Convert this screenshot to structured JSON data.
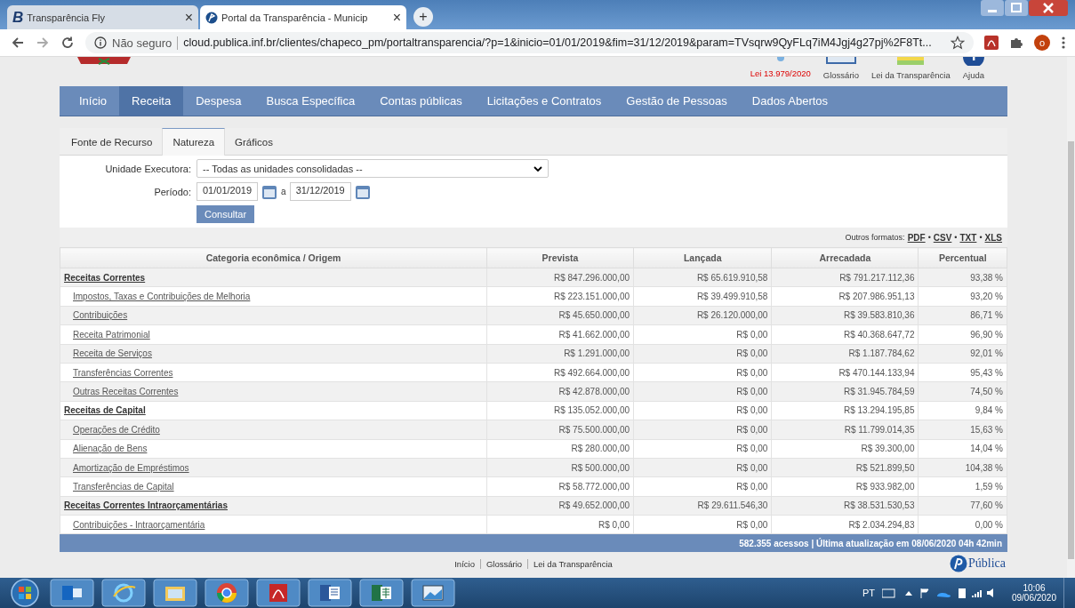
{
  "browser": {
    "tabs": [
      {
        "logo": "B",
        "title": "Transparência Fly",
        "close": "×",
        "selected": false
      },
      {
        "title": "Portal da Transparência - Municip",
        "close": "×",
        "selected": true
      }
    ],
    "new_tab": "+",
    "address": {
      "security": "Não seguro",
      "url": "cloud.publica.inf.br/clientes/chapeco_pm/portaltransparencia/?p=1&inicio=01/01/2019&fim=31/12/2019&param=TVsqrw9QyFLq7iM4Jgj4g27pj%2F8Tt..."
    },
    "profile": "o"
  },
  "header_links": [
    {
      "label": "Lei 13.979/2020",
      "highlight": true
    },
    {
      "label": "Glossário",
      "highlight": false
    },
    {
      "label": "Lei da Transparência",
      "highlight": false
    },
    {
      "label": "Ajuda",
      "highlight": false
    }
  ],
  "nav": [
    {
      "label": "Início",
      "selected": false
    },
    {
      "label": "Receita",
      "selected": true
    },
    {
      "label": "Despesa",
      "selected": false
    },
    {
      "label": "Busca Específica",
      "selected": false
    },
    {
      "label": "Contas públicas",
      "selected": false
    },
    {
      "label": "Licitações e Contratos",
      "selected": false
    },
    {
      "label": "Gestão de Pessoas",
      "selected": false
    },
    {
      "label": "Dados Abertos",
      "selected": false
    }
  ],
  "subtabs": [
    {
      "label": "Fonte de Recurso",
      "selected": false
    },
    {
      "label": "Natureza",
      "selected": true
    },
    {
      "label": "Gráficos",
      "selected": false
    }
  ],
  "form": {
    "unit_label": "Unidade Executora:",
    "unit_value": "-- Todas as unidades consolidadas --",
    "period_label": "Período:",
    "date_from": "01/01/2019",
    "between": "a",
    "date_to": "31/12/2019",
    "submit": "Consultar"
  },
  "export": {
    "label": "Outros formatos:",
    "separator": "•",
    "formats": [
      "PDF",
      "CSV",
      "TXT",
      "XLS"
    ]
  },
  "table": {
    "columns": [
      "Categoria econômica / Origem",
      "Prevista",
      "Lançada",
      "Arrecadada",
      "Percentual"
    ],
    "rows": [
      {
        "label": "Receitas Correntes",
        "values": [
          "R$ 847.296.000,00",
          "R$ 65.619.910,58",
          "R$ 791.217.112,36",
          "93,38 %"
        ],
        "children": [
          {
            "label": "Impostos, Taxas e Contribuições de Melhoria",
            "values": [
              "R$ 223.151.000,00",
              "R$ 39.499.910,58",
              "R$ 207.986.951,13",
              "93,20 %"
            ]
          },
          {
            "label": "Contribuições",
            "values": [
              "R$ 45.650.000,00",
              "R$ 26.120.000,00",
              "R$ 39.583.810,36",
              "86,71 %"
            ]
          },
          {
            "label": "Receita Patrimonial",
            "values": [
              "R$ 41.662.000,00",
              "R$ 0,00",
              "R$ 40.368.647,72",
              "96,90 %"
            ]
          },
          {
            "label": "Receita de Serviços",
            "values": [
              "R$ 1.291.000,00",
              "R$ 0,00",
              "R$ 1.187.784,62",
              "92,01 %"
            ]
          },
          {
            "label": "Transferências Correntes",
            "values": [
              "R$ 492.664.000,00",
              "R$ 0,00",
              "R$ 470.144.133,94",
              "95,43 %"
            ]
          },
          {
            "label": "Outras Receitas Correntes",
            "values": [
              "R$ 42.878.000,00",
              "R$ 0,00",
              "R$ 31.945.784,59",
              "74,50 %"
            ]
          }
        ]
      },
      {
        "label": "Receitas de Capital",
        "values": [
          "R$ 135.052.000,00",
          "R$ 0,00",
          "R$ 13.294.195,85",
          "9,84 %"
        ],
        "children": [
          {
            "label": "Operações de Crédito",
            "values": [
              "R$ 75.500.000,00",
              "R$ 0,00",
              "R$ 11.799.014,35",
              "15,63 %"
            ]
          },
          {
            "label": "Alienação de Bens",
            "values": [
              "R$ 280.000,00",
              "R$ 0,00",
              "R$ 39.300,00",
              "14,04 %"
            ]
          },
          {
            "label": "Amortização de Empréstimos",
            "values": [
              "R$ 500.000,00",
              "R$ 0,00",
              "R$ 521.899,50",
              "104,38 %"
            ]
          },
          {
            "label": "Transferências de Capital",
            "values": [
              "R$ 58.772.000,00",
              "R$ 0,00",
              "R$ 933.982,00",
              "1,59 %"
            ]
          }
        ]
      },
      {
        "label": "Receitas Correntes Intraorçamentárias",
        "values": [
          "R$ 49.652.000,00",
          "R$ 29.611.546,30",
          "R$ 38.531.530,53",
          "77,60 %"
        ],
        "children": [
          {
            "label": "Contribuições - Intraorçamentária",
            "values": [
              "R$ 0,00",
              "R$ 0,00",
              "R$ 2.034.294,83",
              "0,00 %"
            ]
          }
        ]
      }
    ],
    "footer": "582.355 acessos | Última atualização em 08/06/2020 04h 42min"
  },
  "footer_links": [
    "Início",
    "Glossário",
    "Lei da Transparência"
  ],
  "brand": "Pública",
  "taskbar": {
    "language": "PT",
    "time": "10:06",
    "date": "09/06/2020"
  }
}
